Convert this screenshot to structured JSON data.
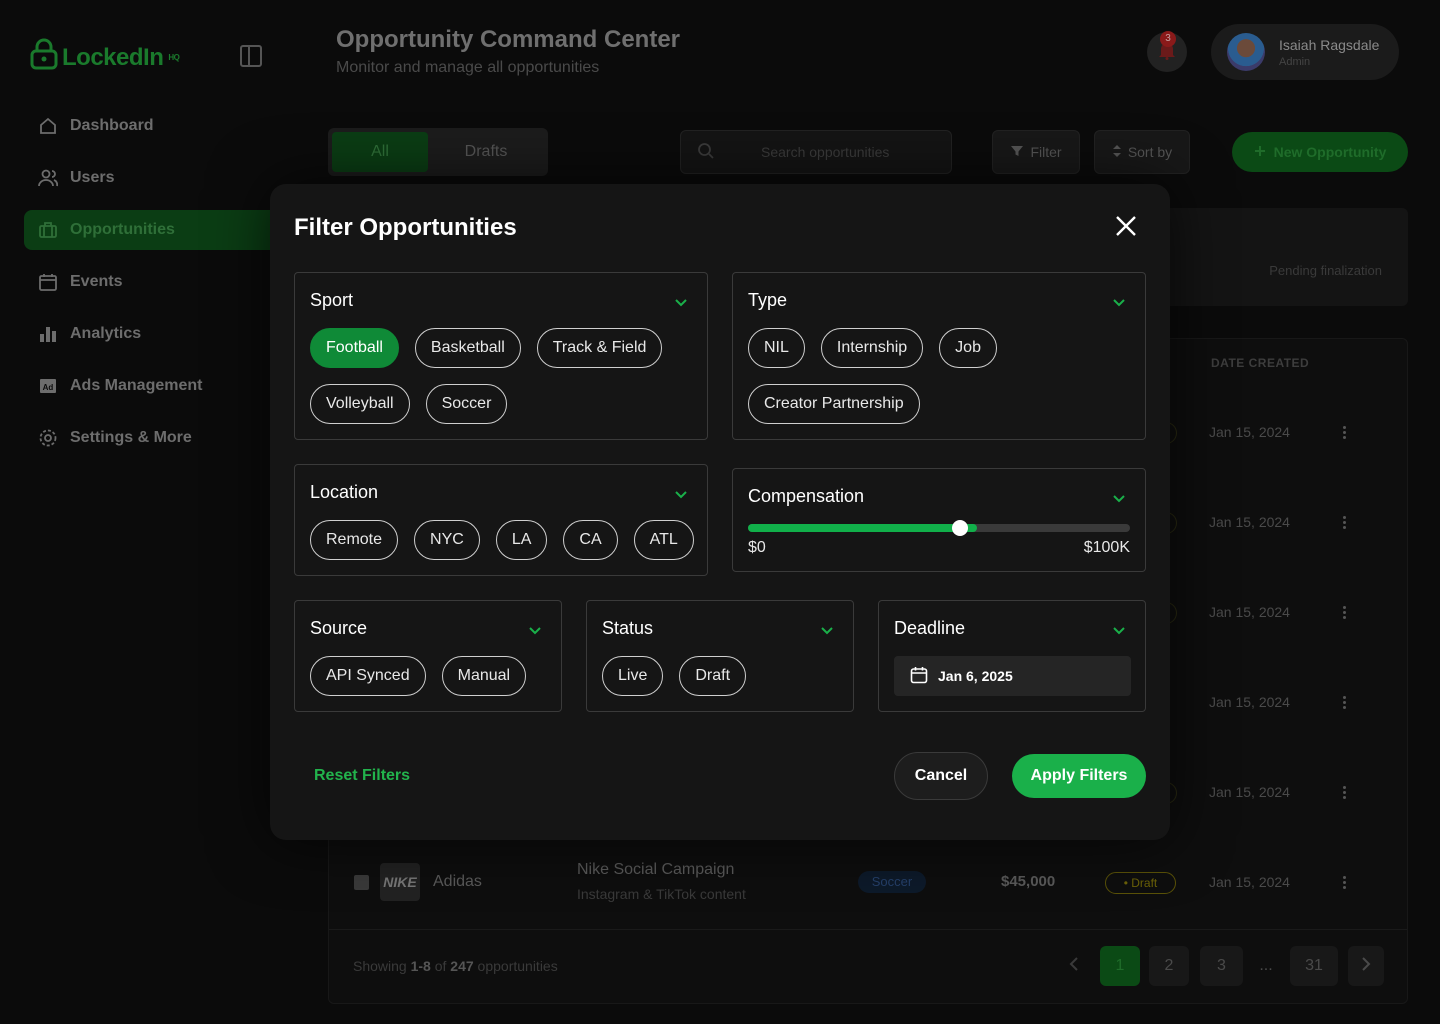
{
  "app": {
    "logo_text": "LockedIn",
    "logo_sup": "HQ"
  },
  "sidebar": {
    "items": [
      {
        "label": "Dashboard",
        "icon": "home-icon"
      },
      {
        "label": "Users",
        "icon": "users-icon"
      },
      {
        "label": "Opportunities",
        "icon": "briefcase-icon",
        "active": true
      },
      {
        "label": "Events",
        "icon": "calendar-icon"
      },
      {
        "label": "Analytics",
        "icon": "bar-chart-icon"
      },
      {
        "label": "Ads Management",
        "icon": "ad-icon"
      },
      {
        "label": "Settings & More",
        "icon": "gear-icon"
      }
    ]
  },
  "header": {
    "title": "Opportunity Command Center",
    "subtitle": "Monitor and manage all opportunities",
    "notification_count": "3",
    "user_name": "Isaiah Ragsdale",
    "user_role": "Admin"
  },
  "toolbar": {
    "tab_all": "All",
    "tab_drafts": "Drafts",
    "search_placeholder": "Search opportunities",
    "filter_label": "Filter",
    "sort_label": "Sort by",
    "new_label": "New Opportunity"
  },
  "stat_card": {
    "text": "Pending finalization"
  },
  "table": {
    "date_header": "DATE CREATED",
    "dates": [
      "Jan 15, 2024",
      "Jan 15, 2024",
      "Jan 15, 2024",
      "Jan 15, 2024",
      "Jan 15, 2024",
      "Jan 15, 2024"
    ],
    "last_row": {
      "brand_logo": "NIKE",
      "brand": "Adidas",
      "title": "Nike Social Campaign",
      "subtitle": "Instagram & TikTok content",
      "sport": "Soccer",
      "amount": "$45,000",
      "status": "Draft"
    },
    "footer": {
      "showing_prefix": "Showing",
      "range": "1-8",
      "of": "of",
      "total": "247",
      "suffix": "opportunities"
    },
    "pages": [
      "1",
      "2",
      "3",
      "...",
      "31"
    ]
  },
  "modal": {
    "title": "Filter Opportunities",
    "sport": {
      "label": "Sport",
      "options": [
        "Football",
        "Basketball",
        "Track & Field",
        "Volleyball",
        "Soccer"
      ],
      "selected": "Football"
    },
    "type": {
      "label": "Type",
      "options": [
        "NIL",
        "Internship",
        "Job",
        "Creator Partnership"
      ]
    },
    "location": {
      "label": "Location",
      "options": [
        "Remote",
        "NYC",
        "LA",
        "CA",
        "ATL"
      ]
    },
    "compensation": {
      "label": "Compensation",
      "min_label": "$0",
      "max_label": "$100K",
      "fill_fraction": 0.6,
      "knob_fraction": 0.555
    },
    "source": {
      "label": "Source",
      "options": [
        "API Synced",
        "Manual"
      ]
    },
    "status": {
      "label": "Status",
      "options": [
        "Live",
        "Draft"
      ]
    },
    "deadline": {
      "label": "Deadline",
      "value": "Jan 6, 2025"
    },
    "reset_label": "Reset Filters",
    "cancel_label": "Cancel",
    "apply_label": "Apply Filters"
  },
  "colors": {
    "accent": "#1ab04a",
    "chip_selected": "#0f8a37",
    "modal_bg": "#151515"
  }
}
